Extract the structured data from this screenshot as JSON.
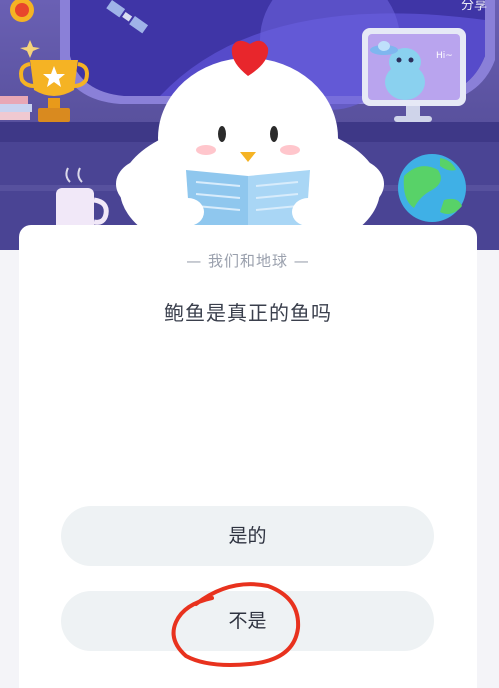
{
  "header": {
    "share_label": "分享"
  },
  "quiz": {
    "subtitle": "— 我们和地球 —",
    "question": "鲍鱼是真正的鱼吗",
    "options": [
      {
        "label": "是的"
      },
      {
        "label": "不是"
      }
    ]
  },
  "scene": {
    "monitor_speech": "Hi~",
    "icons": [
      "trophy-icon",
      "satellite-icon",
      "earth-globe-icon",
      "alien-monitor-icon",
      "coffee-mug-icon",
      "chick-mascot-icon"
    ]
  },
  "colors": {
    "scene_bg": "#5a529f",
    "annotation": "#e8321e",
    "option_bg": "#eef2f4",
    "mascot_crest": "#e8262c"
  }
}
